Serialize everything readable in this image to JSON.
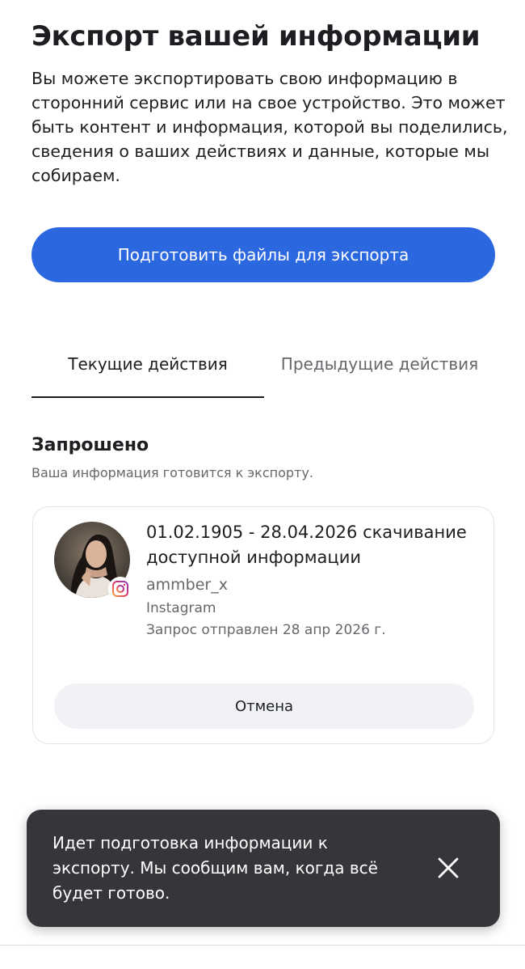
{
  "page": {
    "title": "Экспорт вашей информации",
    "description": "Вы можете экспортировать свою информацию в сторонний сервис или на свое устройство. Это может быть контент и информация, которой вы поделились, сведения о ваших действиях и данные, которые мы собираем."
  },
  "primary_button": {
    "label": "Подготовить файлы для экспорта",
    "color": "#2b68e0"
  },
  "tabs": [
    {
      "label": "Текущие действия",
      "active": true
    },
    {
      "label": "Предыдущие действия",
      "active": false
    }
  ],
  "section": {
    "title": "Запрошено",
    "subtitle": "Ваша информация готовится к экспорту."
  },
  "request_card": {
    "title": "01.02.1905 - 28.04.2026 скачивание доступной информации",
    "username": "ammber_x",
    "platform": "Instagram",
    "sent": "Запрос отправлен 28 апр 2026 г.",
    "avatar_icon": "profile-photo",
    "badge_icon": "instagram-icon",
    "cancel_label": "Отмена"
  },
  "toast": {
    "message": "Идет подготовка информации к экспорту. Мы сообщим вам, когда всё будет готово.",
    "close_icon": "close-icon"
  }
}
